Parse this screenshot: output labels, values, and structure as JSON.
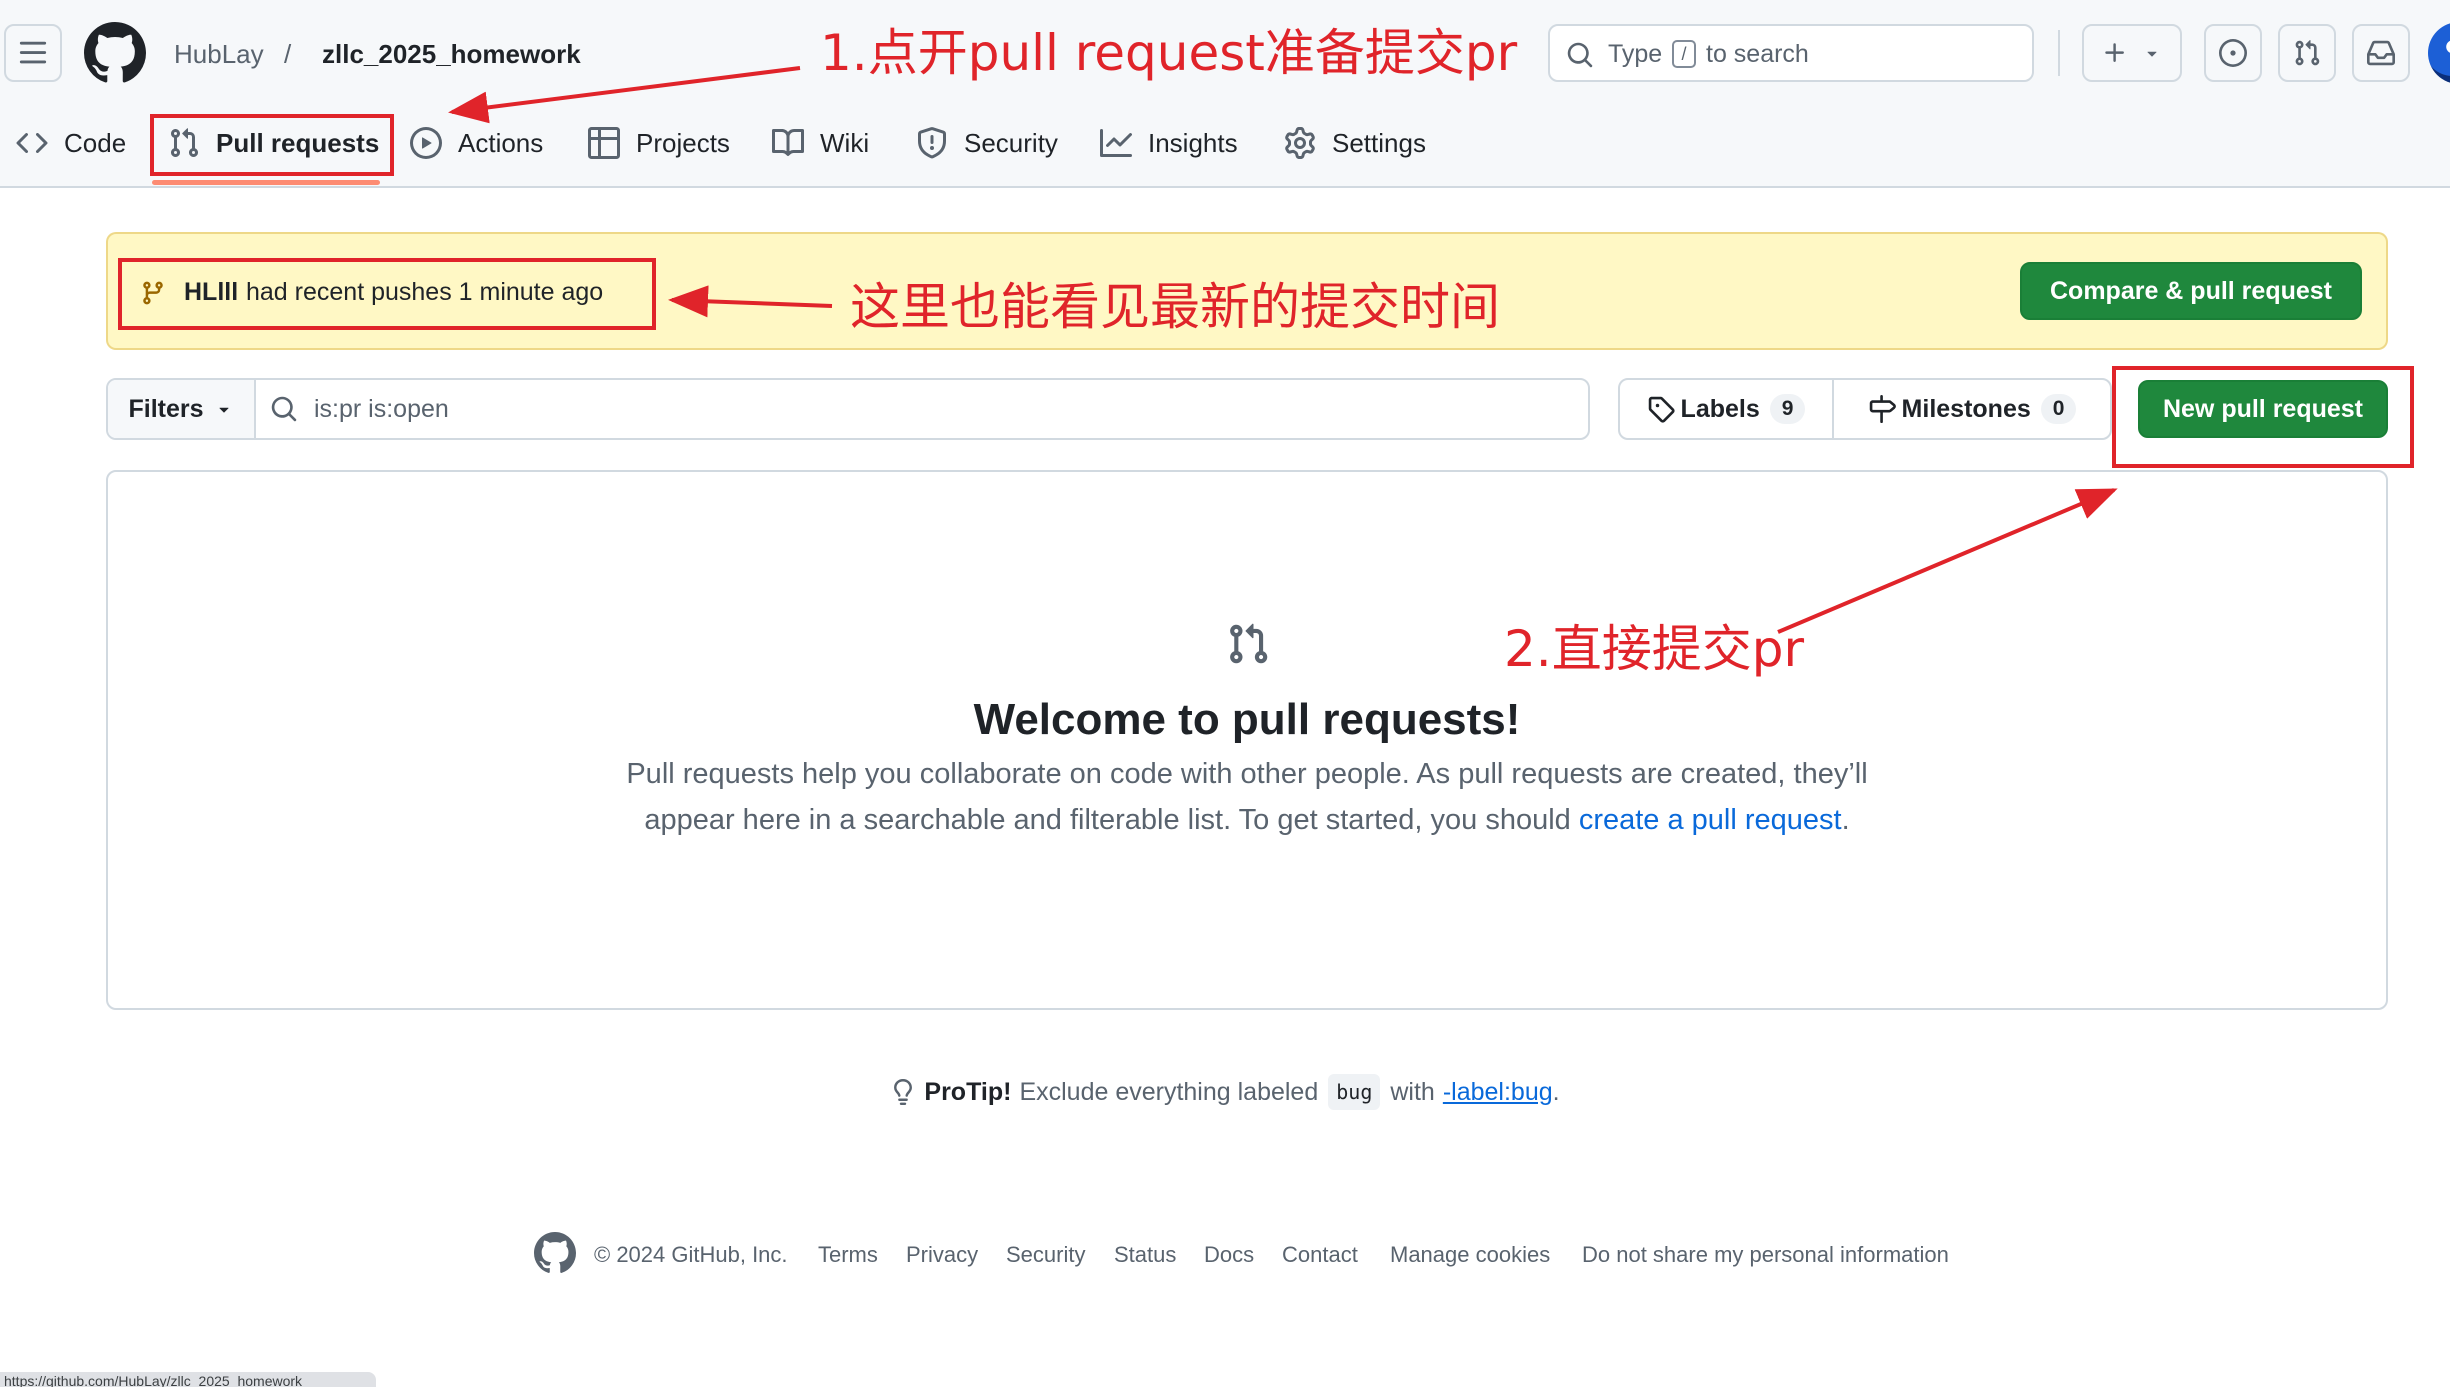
{
  "header": {
    "owner": "HubLay",
    "separator": "/",
    "repo": "zllc_2025_homework",
    "search": {
      "prefix": "Type",
      "key": "/",
      "suffix": "to search"
    }
  },
  "tabs": [
    {
      "label": "Code",
      "icon": "code-icon"
    },
    {
      "label": "Pull requests",
      "icon": "git-pull-request-icon",
      "selected": true
    },
    {
      "label": "Actions",
      "icon": "play-icon"
    },
    {
      "label": "Projects",
      "icon": "table-icon"
    },
    {
      "label": "Wiki",
      "icon": "book-icon"
    },
    {
      "label": "Security",
      "icon": "shield-icon"
    },
    {
      "label": "Insights",
      "icon": "graph-icon"
    },
    {
      "label": "Settings",
      "icon": "gear-icon"
    }
  ],
  "banner": {
    "branch": "HLlll",
    "text": "had recent pushes 1 minute ago",
    "button": "Compare & pull request"
  },
  "filters": {
    "button": "Filters",
    "query": "is:pr is:open",
    "labels": "Labels",
    "labels_count": "9",
    "milestones": "Milestones",
    "milestones_count": "0",
    "new_pr": "New pull request"
  },
  "blankslate": {
    "title": "Welcome to pull requests!",
    "line1": "Pull requests help you collaborate on code with other people. As pull requests are created, they’ll",
    "line2": "appear here in a searchable and filterable list. To get started, you should ",
    "link": "create a pull request",
    "end": "."
  },
  "protip": {
    "lead": "ProTip!",
    "text": "Exclude everything labeled",
    "code": "bug",
    "with": "with",
    "link": "-label:bug",
    "end": "."
  },
  "footer": {
    "copyright": "© 2024 GitHub, Inc.",
    "links": [
      "Terms",
      "Privacy",
      "Security",
      "Status",
      "Docs",
      "Contact",
      "Manage cookies",
      "Do not share my personal information"
    ]
  },
  "status_url": "https://github.com/HubLay/zllc_2025_homework",
  "annotations": {
    "step1": "1.点开pull request准备提交pr",
    "note": "这里也能看见最新的提交时间",
    "step2": "2.直接提交pr"
  },
  "colors": {
    "accent_red": "#e0242a",
    "green": "#1f883d",
    "link": "#0969da",
    "tab_underline": "#fd8c73"
  }
}
